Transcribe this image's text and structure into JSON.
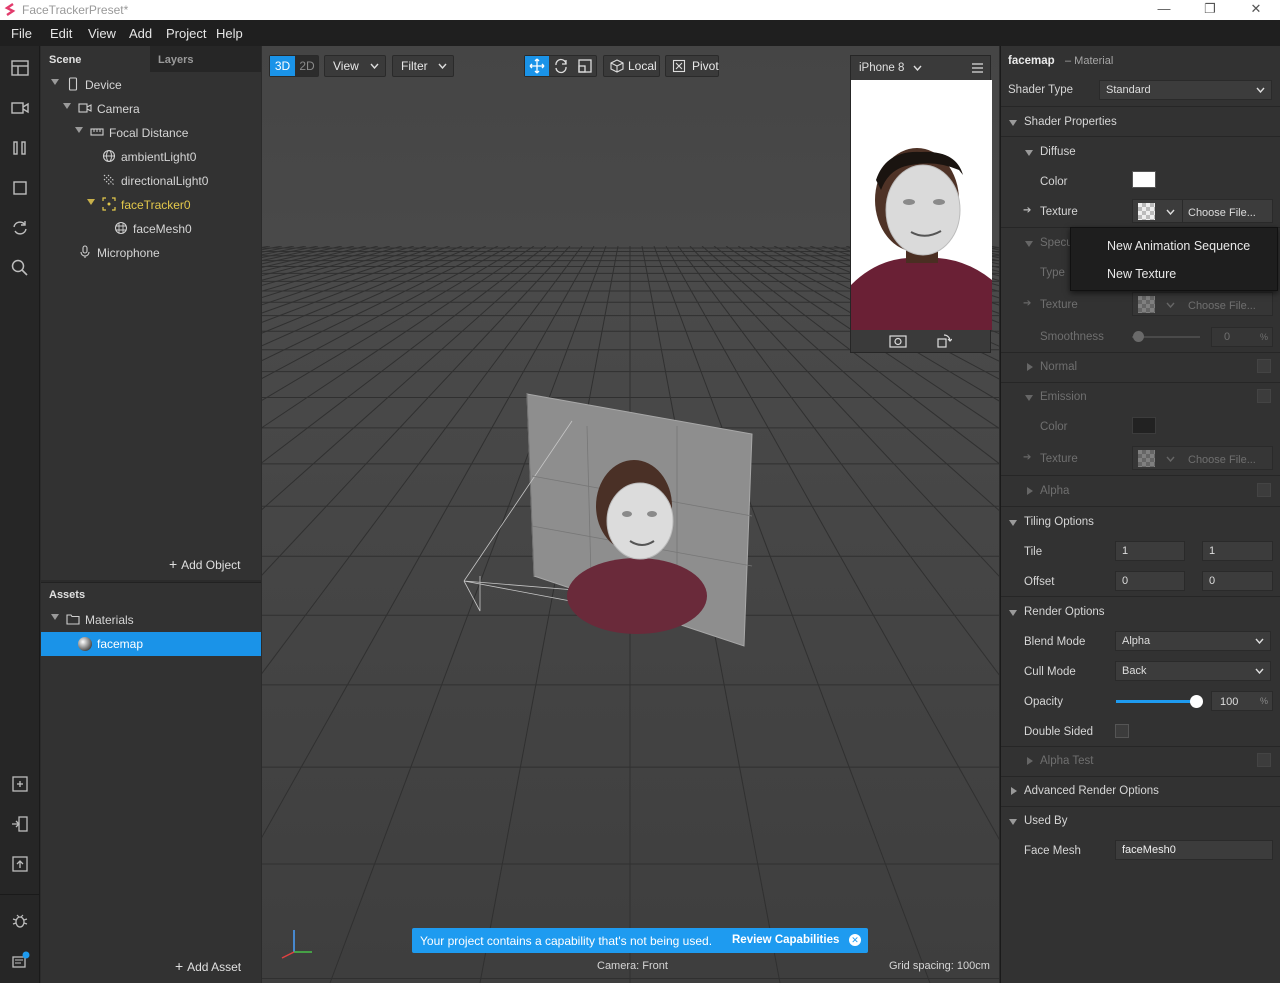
{
  "app": {
    "title": "FaceTrackerPreset*"
  },
  "window_controls": {
    "minimize": "—",
    "restore": "❐",
    "close": "✕"
  },
  "menu": [
    "File",
    "Edit",
    "View",
    "Add",
    "Project",
    "Help"
  ],
  "scene_panel": {
    "tabs": [
      "Scene",
      "Layers"
    ],
    "tree": [
      {
        "label": "Device",
        "icon": "phone-icon"
      },
      {
        "label": "Camera",
        "icon": "camera-icon"
      },
      {
        "label": "Focal Distance",
        "icon": "ruler-icon"
      },
      {
        "label": "ambientLight0",
        "icon": "globe-light-icon"
      },
      {
        "label": "directionalLight0",
        "icon": "directional-light-icon"
      },
      {
        "label": "faceTracker0",
        "icon": "face-tracker-icon"
      },
      {
        "label": "faceMesh0",
        "icon": "mesh-icon"
      },
      {
        "label": "Microphone",
        "icon": "microphone-icon"
      }
    ],
    "add_object": "Add Object"
  },
  "assets_panel": {
    "title": "Assets",
    "folder": "Materials",
    "selected_item": "facemap",
    "add_asset": "Add Asset"
  },
  "viewport": {
    "mode_3d": "3D",
    "mode_2d": "2D",
    "view_menu": "View",
    "filter_menu": "Filter",
    "local_label": "Local",
    "pivot_label": "Pivot",
    "camera_status": "Camera: Front",
    "grid_spacing": "Grid spacing: 100cm",
    "notice_text": "Your project contains a capability that's not being used.",
    "notice_action": "Review Capabilities",
    "device_preview": "iPhone 8"
  },
  "inspector": {
    "object_name": "facemap",
    "object_type": "– Material",
    "shader_type_label": "Shader Type",
    "shader_type_value": "Standard",
    "shader_properties": "Shader Properties",
    "diffuse": "Diffuse",
    "color_label": "Color",
    "texture_label": "Texture",
    "choose_file": "Choose File...",
    "specular": "Specu",
    "type_label": "Type",
    "smoothness_label": "Smoothness",
    "smoothness_value": "0",
    "percent": "%",
    "normal": "Normal",
    "emission": "Emission",
    "alpha": "Alpha",
    "tiling_options": "Tiling Options",
    "tile_label": "Tile",
    "tile_x": "1",
    "tile_y": "1",
    "offset_label": "Offset",
    "offset_x": "0",
    "offset_y": "0",
    "render_options": "Render Options",
    "blend_mode_label": "Blend Mode",
    "blend_mode_value": "Alpha",
    "cull_mode_label": "Cull Mode",
    "cull_mode_value": "Back",
    "opacity_label": "Opacity",
    "opacity_value": "100",
    "opacity_fraction": 1.0,
    "double_sided_label": "Double Sided",
    "alpha_test": "Alpha Test",
    "advanced_render_options": "Advanced Render Options",
    "used_by": "Used By",
    "face_mesh_label": "Face Mesh",
    "face_mesh_value": "faceMesh0"
  },
  "texture_popup": {
    "items": [
      "New Animation Sequence",
      "New Texture"
    ]
  },
  "colors": {
    "accent": "#1e9bf0",
    "selection": "#1a93e8",
    "tracker_yellow": "#e3c84b"
  }
}
